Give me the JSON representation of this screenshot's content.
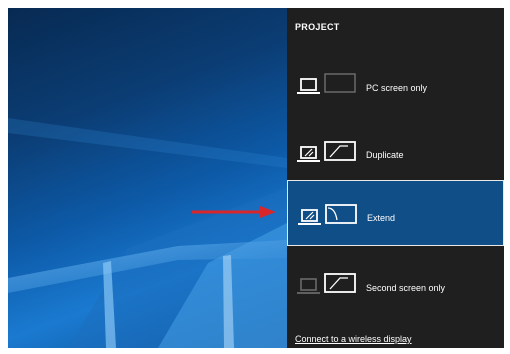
{
  "panel": {
    "title": "PROJECT",
    "options": [
      {
        "label": "PC screen only",
        "selected": false,
        "icon": "pc-screen-only-icon"
      },
      {
        "label": "Duplicate",
        "selected": false,
        "icon": "duplicate-icon"
      },
      {
        "label": "Extend",
        "selected": true,
        "icon": "extend-icon"
      },
      {
        "label": "Second screen only",
        "selected": false,
        "icon": "second-screen-only-icon"
      }
    ],
    "connect_link": "Connect to a wireless display"
  },
  "colors": {
    "panel_background": "#1f1f1f",
    "selected_background": "#0f4e86",
    "annotation_arrow": "#d9262b",
    "text": "#ffffff"
  }
}
